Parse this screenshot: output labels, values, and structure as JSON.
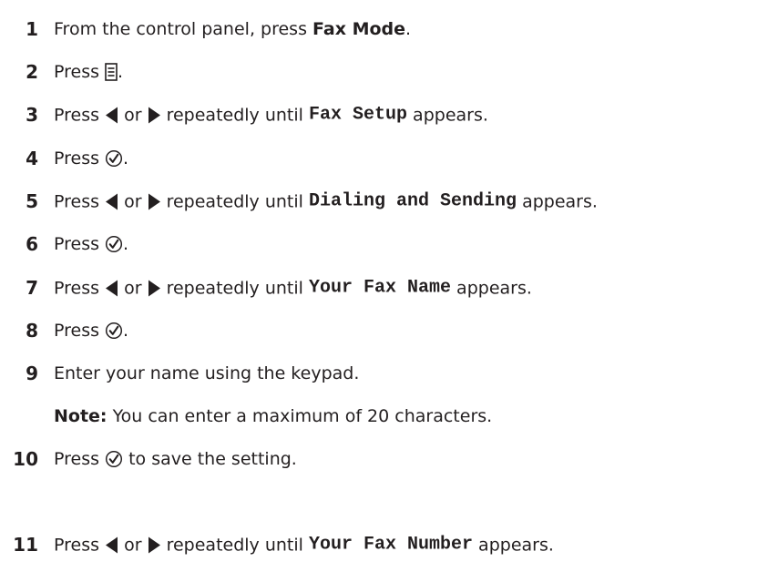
{
  "steps": [
    {
      "num": "1",
      "a": "From the control panel, press ",
      "b": "Fax Mode",
      "c": "."
    },
    {
      "num": "2",
      "a": "Press ",
      "c": "."
    },
    {
      "num": "3",
      "a": "Press ",
      "or": " or ",
      "r": " repeatedly until ",
      "code": "Fax Setup",
      "end": " appears."
    },
    {
      "num": "4",
      "a": "Press ",
      "c": "."
    },
    {
      "num": "5",
      "a": "Press ",
      "or": " or ",
      "r": " repeatedly until ",
      "code": "Dialing and Sending",
      "end": " appears."
    },
    {
      "num": "6",
      "a": "Press ",
      "c": "."
    },
    {
      "num": "7",
      "a": "Press ",
      "or": " or ",
      "r": " repeatedly until ",
      "code": "Your Fax Name",
      "end": " appears."
    },
    {
      "num": "8",
      "a": "Press ",
      "c": "."
    },
    {
      "num": "9",
      "a": "Enter your name using the keypad."
    },
    {
      "num": "10",
      "a": "Press ",
      "c": " to save the setting."
    },
    {
      "num": "11",
      "a": "Press ",
      "or": " or ",
      "r": " repeatedly until ",
      "code": "Your Fax Number",
      "end": " appears."
    }
  ],
  "note": {
    "label": "Note:",
    "text": " You can enter a maximum of 20 characters."
  },
  "icons": {
    "menu": "menu-icon",
    "left": "left-arrow-icon",
    "right": "right-arrow-icon",
    "select": "checkmark-circle-icon"
  },
  "colors": {
    "text": "#231f20"
  }
}
